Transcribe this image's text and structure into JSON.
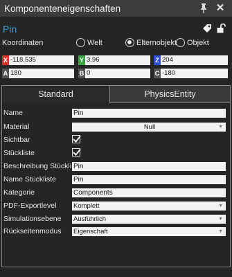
{
  "window": {
    "title": "Komponenteneigenschaften"
  },
  "header": {
    "object_name": "Pin"
  },
  "coordinates": {
    "label": "Koordinaten",
    "options": [
      {
        "label": "Welt",
        "selected": false
      },
      {
        "label": "Elternobjekt",
        "selected": true
      },
      {
        "label": "Objekt",
        "selected": false
      }
    ],
    "position": [
      {
        "axis": "X",
        "value": "-118.535",
        "color": "#d9342b"
      },
      {
        "axis": "Y",
        "value": "3.96",
        "color": "#3aa043"
      },
      {
        "axis": "Z",
        "value": "204",
        "color": "#2d4fd3"
      }
    ],
    "rotation": [
      {
        "axis": "A",
        "value": "180",
        "color": "#555555"
      },
      {
        "axis": "B",
        "value": "0",
        "color": "#555555"
      },
      {
        "axis": "C",
        "value": "-180",
        "color": "#555555"
      }
    ]
  },
  "tabs": [
    {
      "label": "Standard",
      "active": true
    },
    {
      "label": "PhysicsEntity",
      "active": false
    }
  ],
  "properties": [
    {
      "label": "Name",
      "kind": "text",
      "value": "Pin"
    },
    {
      "label": "Material",
      "kind": "select",
      "value": "Null"
    },
    {
      "label": "Sichtbar",
      "kind": "checkbox",
      "checked": true
    },
    {
      "label": "Stückliste",
      "kind": "checkbox",
      "checked": true
    },
    {
      "label": "Beschreibung Stückli...",
      "kind": "text",
      "value": "Pin"
    },
    {
      "label": "Name Stückliste",
      "kind": "text",
      "value": "Pin"
    },
    {
      "label": "Kategorie",
      "kind": "text",
      "value": "Components"
    },
    {
      "label": "PDF-Exportlevel",
      "kind": "select",
      "value": "Komplett"
    },
    {
      "label": "Simulationsebene",
      "kind": "select",
      "value": "Ausführlich"
    },
    {
      "label": "Rückseitenmodus",
      "kind": "select",
      "value": "Eigenschaft"
    }
  ],
  "icons": {
    "pin": "pin-icon",
    "close": "close-icon",
    "tag": "tag-icon",
    "lock": "unlock-icon",
    "dropdown": "chevron-down-icon",
    "check": "checkmark-icon"
  }
}
